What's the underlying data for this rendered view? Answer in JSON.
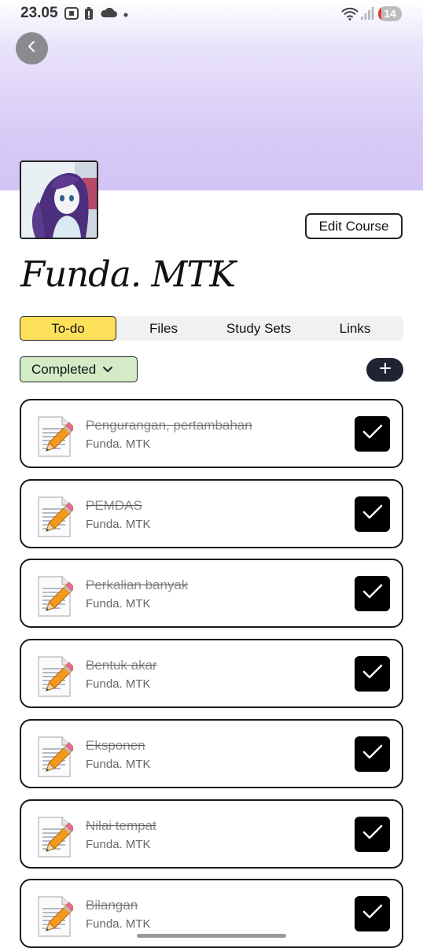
{
  "status_bar": {
    "time": "23.05",
    "battery": "14",
    "battery_level": 0.14
  },
  "header": {
    "edit_label": "Edit Course"
  },
  "course": {
    "title": "Funda. MTK"
  },
  "tabs": [
    {
      "label": "To-do",
      "active": true
    },
    {
      "label": "Files",
      "active": false
    },
    {
      "label": "Study Sets",
      "active": false
    },
    {
      "label": "Links",
      "active": false
    }
  ],
  "filter": {
    "label": "Completed"
  },
  "colors": {
    "header_gradient": "#d2c3f5",
    "active_tab": "#fde15a",
    "filter_bg": "#d3ecc7",
    "add_button": "#202432"
  },
  "tasks": [
    {
      "title": "Pengurangan, pertambahan",
      "course": "Funda. MTK",
      "done": true
    },
    {
      "title": "PEMDAS",
      "course": "Funda. MTK",
      "done": true
    },
    {
      "title": "Perkalian banyak",
      "course": "Funda. MTK",
      "done": true
    },
    {
      "title": "Bentuk akar",
      "course": "Funda. MTK",
      "done": true
    },
    {
      "title": "Eksponen",
      "course": "Funda. MTK",
      "done": true
    },
    {
      "title": "Nilai tempat",
      "course": "Funda. MTK",
      "done": true
    },
    {
      "title": "Bilangan",
      "course": "Funda. MTK",
      "done": true
    }
  ]
}
